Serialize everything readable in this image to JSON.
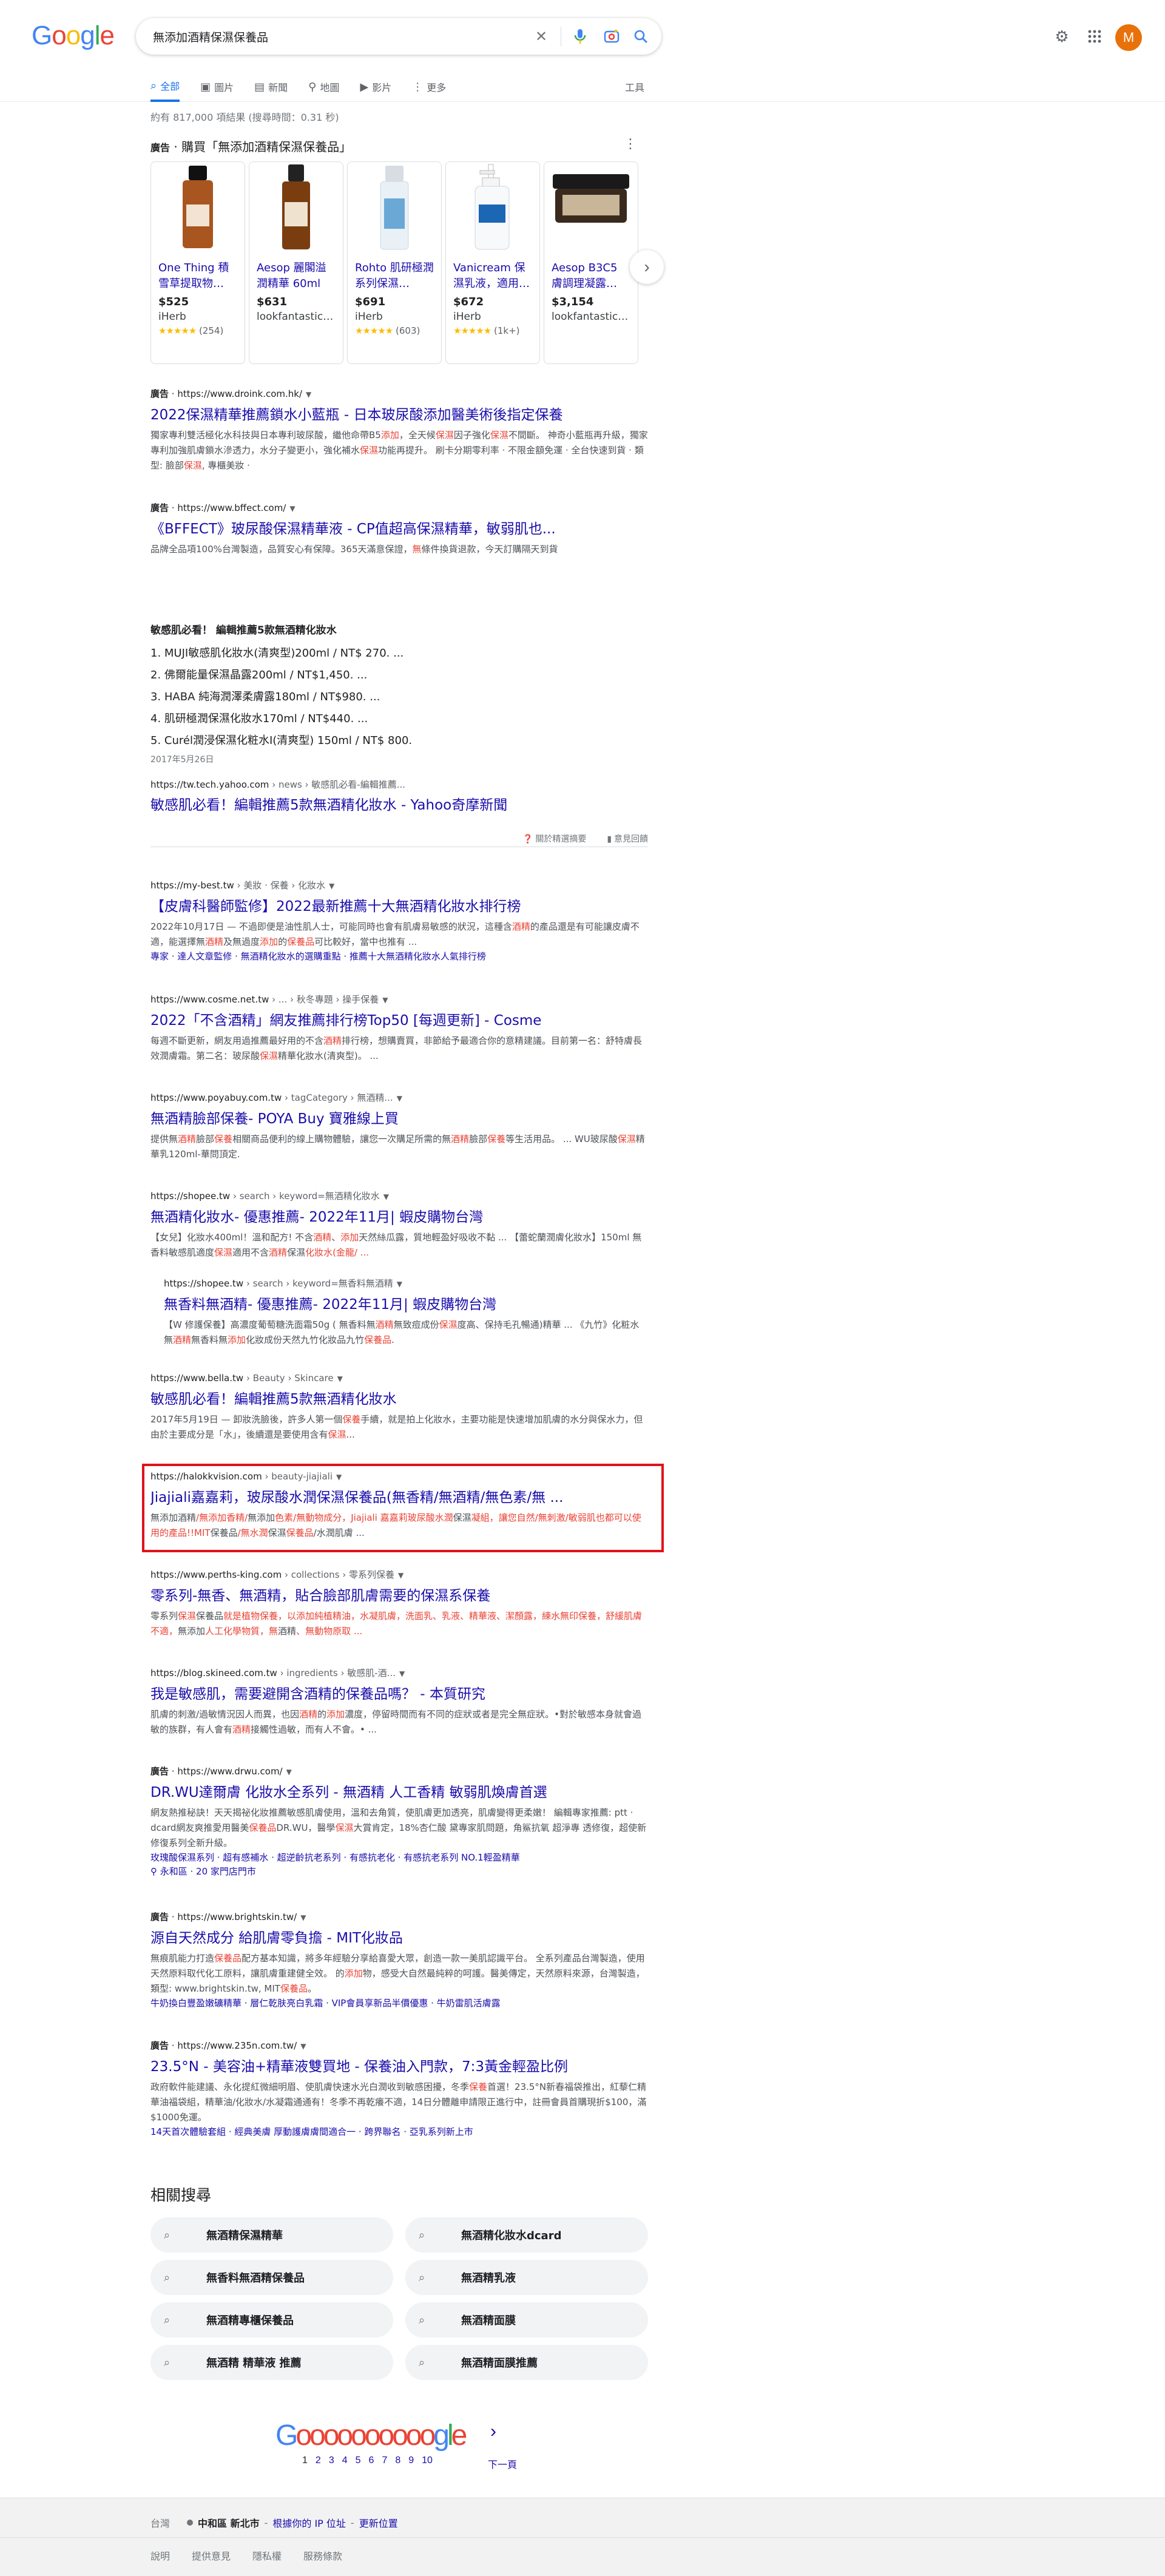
{
  "search": {
    "query": "無添加酒精保濕保養品"
  },
  "tabs": [
    {
      "label": "全部",
      "icon": "search-icon"
    },
    {
      "label": "圖片",
      "icon": "image-icon"
    },
    {
      "label": "新聞",
      "icon": "news-icon"
    },
    {
      "label": "地圖",
      "icon": "map-pin-icon"
    },
    {
      "label": "影片",
      "icon": "video-icon"
    },
    {
      "label": "更多",
      "icon": "more-vertical-icon"
    }
  ],
  "tools_label": "工具",
  "account_initial": "M",
  "stats": "約有 817,000 項結果 (搜尋時間：0.31 秒)",
  "shopping": {
    "ad_label": "廣告",
    "heading": " · 購買「無添加酒精保濕保養品」",
    "products": [
      {
        "title": "One Thing 積雪草提取物…",
        "price": "$525",
        "store": "iHerb",
        "stars": "★★★★★",
        "reviews": "(254)"
      },
      {
        "title": "Aesop 麗閣溢潤精華 60ml",
        "price": "$631",
        "store": "lookfantastic…",
        "stars": "",
        "reviews": ""
      },
      {
        "title": "Rohto 肌研極潤系列保濕…",
        "price": "$691",
        "store": "iHerb",
        "stars": "★★★★★",
        "reviews": "(603)"
      },
      {
        "title": "Vanicream 保濕乳液，適用…",
        "price": "$672",
        "store": "iHerb",
        "stars": "★★★★★",
        "reviews": "(1k+)"
      },
      {
        "title": "Aesop B3C5 膚調理凝露…",
        "price": "$3,154",
        "store": "lookfantastic…",
        "stars": "",
        "reviews": ""
      }
    ]
  },
  "results": [
    {
      "ad": "廣告",
      "cite": "https://www.droink.com.hk/",
      "path": "",
      "title": "2022保濕精華推薦鎖水小藍瓶 - 日本玻尿酸添加醫美術後指定保養",
      "snippet": [
        "獨家專利雙活極化水科技與日本專利玻尿酸，繼他命帶B5",
        "添加",
        "，全天候",
        "保濕",
        "因子強化",
        "保濕",
        "不間斷。 神奇小藍瓶再升級，獨家專利加強肌膚鎖水滲透力，水分子變更小，強化補水",
        "保濕",
        "功能再提升。 刷卡分期零利率 · 不限金額免運 · 全台快速到貨 · 類型: 臉部",
        "保濕",
        ", 專櫃美妝 ·"
      ],
      "sublinks": ""
    },
    {
      "ad": "廣告",
      "cite": "https://www.bffect.com/",
      "path": "",
      "title": "《BFFECT》玻尿酸保濕精華液 - CP值超高保濕精華，敏弱肌也...",
      "snippet": [
        "品牌全品項100%台灣製造，品質安心有保障。365天滿意保證，",
        "無",
        "條件換貨退款，今天訂購隔天到貨"
      ],
      "sublinks": ""
    },
    {
      "ad": "",
      "cite": "https://tw.tech.yahoo.com",
      "path": " › news › 敏感肌必看-編輯推薦...",
      "title": "敏感肌必看！編輯推薦5款無酒精化妝水 - Yahoo奇摩新聞",
      "snippet": [],
      "sublinks": ""
    },
    {
      "ad": "",
      "cite": "https://my-best.tw",
      "path": " › 美妝 · 保養 › 化妝水",
      "title": "【皮膚科醫師監修】2022最新推薦十大無酒精化妝水排行榜",
      "snippet": [
        "2022年10月17日 — 不過即便是油性肌人士，可能同時也會有肌膚易敏感的狀況，這種含",
        "酒精",
        "的產品還是有可能讓皮膚不適，能選擇無",
        "酒精",
        "及無過度",
        "添加",
        "的",
        "保養品",
        "可比較好，當中也推有 ..."
      ],
      "sublinks": "專家 · 達人文章監修 · 無酒精化妝水的選購重點 · 推薦十大無酒精化妝水人氣排行榜"
    },
    {
      "ad": "",
      "cite": "https://www.cosme.net.tw",
      "path": " › ... › 秋冬專題 › 操手保養",
      "title": "2022「不含酒精」網友推薦排行榜Top50 [每週更新] - Cosme",
      "snippet": [
        "每週不斷更新，網友用過推薦最好用的不含",
        "酒精",
        "排行榜，想購賣買，非節給予最適合你的意精建議。目前第一名：舒特膚長效潤膚霜。第二名：玻尿酸",
        "保濕",
        "精華化妝水(清爽型)。 ..."
      ],
      "sublinks": ""
    },
    {
      "ad": "",
      "cite": "https://www.poyabuy.com.tw",
      "path": " › tagCategory › 無酒精...",
      "title": "無酒精臉部保養- POYA Buy 寶雅線上買",
      "snippet": [
        "提供無",
        "酒精",
        "臉部",
        "保養",
        "相關商品便利的線上購物體驗，讓您一次購足所需的無",
        "酒精",
        "臉部",
        "保養",
        "等生活用品。 ... WU玻尿酸",
        "保濕",
        "精華乳120ml-華問頂定."
      ],
      "sublinks": ""
    },
    {
      "ad": "",
      "cite": "https://shopee.tw",
      "path": " › search › keyword=無酒精化妝水",
      "title": "無酒精化妝水- 優惠推薦- 2022年11月| 蝦皮購物台灣",
      "snippet": [
        "【女兒】化妝水400ml！溫和配方! 不含",
        "酒精",
        "、",
        "添加",
        "天然絲瓜露，質地輕盈好吸收不黏 ... 【蕾蛇蘭潤膚化妝水】150ml 無香料敏感肌適度",
        "保濕",
        "適用不含",
        "酒精",
        "保濕",
        "化妝水(金龍/ ..."
      ],
      "sublinks": ""
    },
    {
      "ad": "",
      "cite": "https://shopee.tw",
      "path": " › search › keyword=無香料無酒精",
      "title": "無香料無酒精- 優惠推薦- 2022年11月| 蝦皮購物台灣",
      "snippet": [
        "【W 修護保養】高濃度葡萄糖洗面霜50g ( 無香料無",
        "酒精",
        "無致痘成份",
        "保濕",
        "度高、保持毛孔暢通)精華 ... 《九竹》化粧水無",
        "酒精",
        "無香料無",
        "添加",
        "化妝成份天然九竹化妝品九竹",
        "保養品",
        "."
      ],
      "sublinks": ""
    },
    {
      "ad": "",
      "cite": "https://www.bella.tw",
      "path": " › Beauty › Skincare",
      "title": "敏感肌必看！編輯推薦5款無酒精化妝水",
      "snippet": [
        "2017年5月19日 — 卸妝洗臉後，許多人第一個",
        "保養",
        "手續，就是拍上化妝水，主要功能是快速增加肌膚的水分與保水力，但由於主要成分是「水」，後續還是要使用含有",
        "保濕",
        "..."
      ],
      "sublinks": ""
    },
    {
      "ad": "",
      "cite": "https://halokkvision.com",
      "path": " › beauty-jiajiali",
      "title": "Jiajiali嘉嘉莉，玻尿酸水潤保濕保養品(無香精/無酒精/無色素/無 ...",
      "snippet": [
        "無添加酒精",
        "/無添加香精/",
        "無添加",
        "色素/無動物成分，Jiajiali 嘉嘉莉玻尿酸水潤",
        "保濕",
        "凝組，讓您自然/無刺激/敏弱肌也都可以使用的產品!!MIT",
        "保養品",
        "/無水潤",
        "保濕",
        "保養品",
        "/水潤肌膚 ..."
      ],
      "sublinks": ""
    },
    {
      "ad": "",
      "cite": "https://www.perths-king.com",
      "path": " › collections › 零系列保養",
      "title": "零系列-無香、無酒精，貼合臉部肌膚需要的保濕系保養",
      "snippet": [
        "零系列",
        "保濕",
        "保養品",
        "就是植物保養，以添加純植精油，水凝肌膚，洗面乳、乳液、精華液、潔顏露，練水無印保養，舒緩肌膚不適，",
        "無添加",
        "人工化學物質，無",
        "酒精",
        "、無動物原取 ..."
      ],
      "sublinks": ""
    },
    {
      "ad": "",
      "cite": "https://blog.skineed.com.tw",
      "path": " › ingredients › 敏感肌-酒...",
      "title": "我是敏感肌，需要避開含酒精的保養品嗎？ - 本質研究",
      "snippet": [
        "肌膚的刺激/過敏情況因人而異，也因",
        "酒精",
        "的",
        "添加",
        "濃度，停留時間而有不同的症狀或者是完全無症狀。•對於敏感本身就會過敏的族群，有人會有",
        "酒精",
        "接觸性過敏，而有人不會。• ..."
      ],
      "sublinks": ""
    },
    {
      "ad": "廣告",
      "cite": "https://www.drwu.com/",
      "path": "",
      "title": "DR.WU達爾膚 化妝水全系列 - 無酒精 人工香精 敏弱肌煥膚首選",
      "snippet": [
        "網友熱推秘訣！天天揭祕化妝推薦敏感肌膚使用，溫和去角質，使肌膚更加透亮，肌膚變得更柔嫩！ 編輯專家推薦: ptt · dcard網友爽推愛用醫美",
        "保養品",
        "DR.WU，醫學",
        "保濕",
        "大賞肯定，18%杏仁酸 黛專家肌問題，角鯊抗氧 超淨專 透修復，超使新修復系列全新升級。"
      ],
      "sublinks": "玫瑰酸保濕系列 · 超有感補水 · 超逆齡抗老系列 · 有感抗老化 · 有感抗老系列 NO.1輕盈精華\n⚲ 永和區 · 20 家門店門市"
    },
    {
      "ad": "廣告",
      "cite": "https://www.brightskin.tw/",
      "path": "",
      "title": "源自天然成分 給肌膚零負擔 - MIT化妝品",
      "snippet": [
        "無痕肌能力打造",
        "保養品",
        "配方基本知識，將多年經驗分享給喜愛大眾，創造一款一美肌認識平台。 全系列產品台灣製造，使用天然原料取代化工原料，讓肌膚重建健全效。 的",
        "添加",
        "物，感受大自然最純粹的呵護。醫美傳定，天然原料來源，台灣製造，類型: www.brightskin.tw, MIT",
        "保養品",
        "。"
      ],
      "sublinks": "牛奶換白豐盈嫩礦精華 · 層仁乾肤亮白乳霜 · VIP會員享新品半價優惠 · 牛奶雷肌活膚露"
    },
    {
      "ad": "廣告",
      "cite": "https://www.235n.com.tw/",
      "path": "",
      "title": "23.5°N - 美容油+精華液雙買地 - 保養油入門款，7:3黃金輕盈比例",
      "snippet": [
        "政府軟件能建議、永化提紅微細明眉、使肌膚快速水光白潤收到敏感困擾，冬季",
        "保養",
        "首選！23.5°N新春福袋推出，紅藜仁精華油福袋組，精華油/化妝水/水凝霜通通有！冬季不再乾癢不適，14日分體離申請限正進行中，註冊會員首購現折$100，滿$1000免運。"
      ],
      "sublinks": "14天首次體驗套組 · 經典美膚 厚動護膚膚間適合一 · 跨界聯名 · 亞乳系列新上市"
    }
  ],
  "featured_snippet": {
    "title": "敏感肌必看！ 編輯推薦5款無酒精化妝水",
    "items": [
      "1. MUJI敏感肌化妝水(清爽型)200ml / NT$ 270. ...",
      "2. 佛爾能量保濕晶露200ml / NT$1,450. ...",
      "3. HABA 純海潤澤柔膚露180ml / NT$980. ...",
      "4. 肌研極潤保濕化妝水170ml / NT$440. ...",
      "5. Curél潤浸保濕化粧水I(清爽型) 150ml / NT$ 800."
    ],
    "date": "2017年5月26日",
    "about_label": "關於精選摘要",
    "feedback_label": "意見回饋"
  },
  "related": {
    "title": "相關搜尋",
    "items": [
      "無酒精保濕精華",
      "無酒精化妝水dcard",
      "無香料無酒精保養品",
      "無酒精乳液",
      "無酒精專櫃保養品",
      "無酒精面膜",
      "無酒精 精華液 推薦",
      "無酒精面膜推薦"
    ]
  },
  "pagination": {
    "logo": "Goooooooooogle",
    "pages": [
      "1",
      "2",
      "3",
      "4",
      "5",
      "6",
      "7",
      "8",
      "9",
      "10"
    ],
    "next_label": "下一頁"
  },
  "footer": {
    "country": "台灣",
    "location": "中和區 新北市",
    "ip_link": "根據你的 IP 位址",
    "update_link": "更新位置",
    "links": [
      "說明",
      "提供意見",
      "隱私權",
      "服務條款"
    ]
  },
  "colors": {
    "link": "#1a0dab",
    "highlight_border": "#e0131b",
    "accent": "#1a73e8",
    "avatar": "#e8710a",
    "emphasis": "#ea4335"
  }
}
